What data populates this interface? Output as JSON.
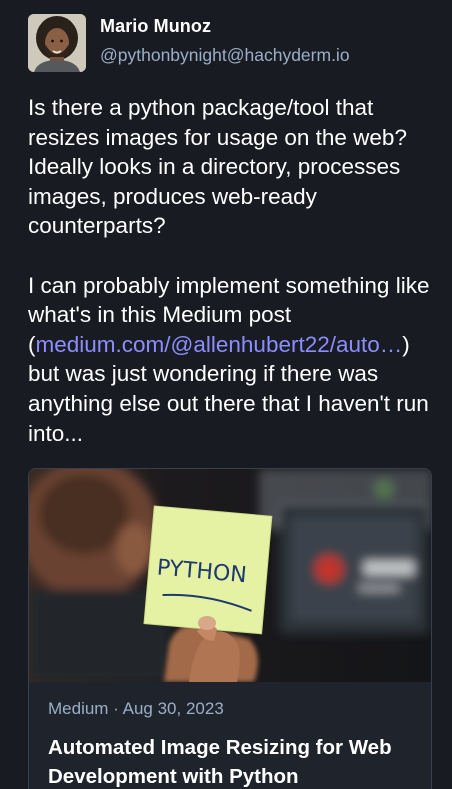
{
  "author": {
    "display_name": "Mario Munoz",
    "handle": "@pythonbynight@hachyderm.io"
  },
  "post": {
    "paragraph1": "Is there a python package/tool that resizes images for usage on the web? Ideally looks in a directory, processes images, produces web-ready counterparts?",
    "paragraph2_before_link": "I can probably implement something like what's in this Medium post (",
    "link_text": "medium.com/@allenhubert22/auto…",
    "paragraph2_after_link": ") but was just wondering if there was anything else out there that I haven't run into..."
  },
  "link_card": {
    "meta": "Medium · Aug 30, 2023",
    "title": "Automated Image Resizing for Web Development with Python",
    "image_text": "PYTHON"
  },
  "colors": {
    "background": "#191b22",
    "handle": "#9baec8",
    "link": "#8c8dff"
  }
}
